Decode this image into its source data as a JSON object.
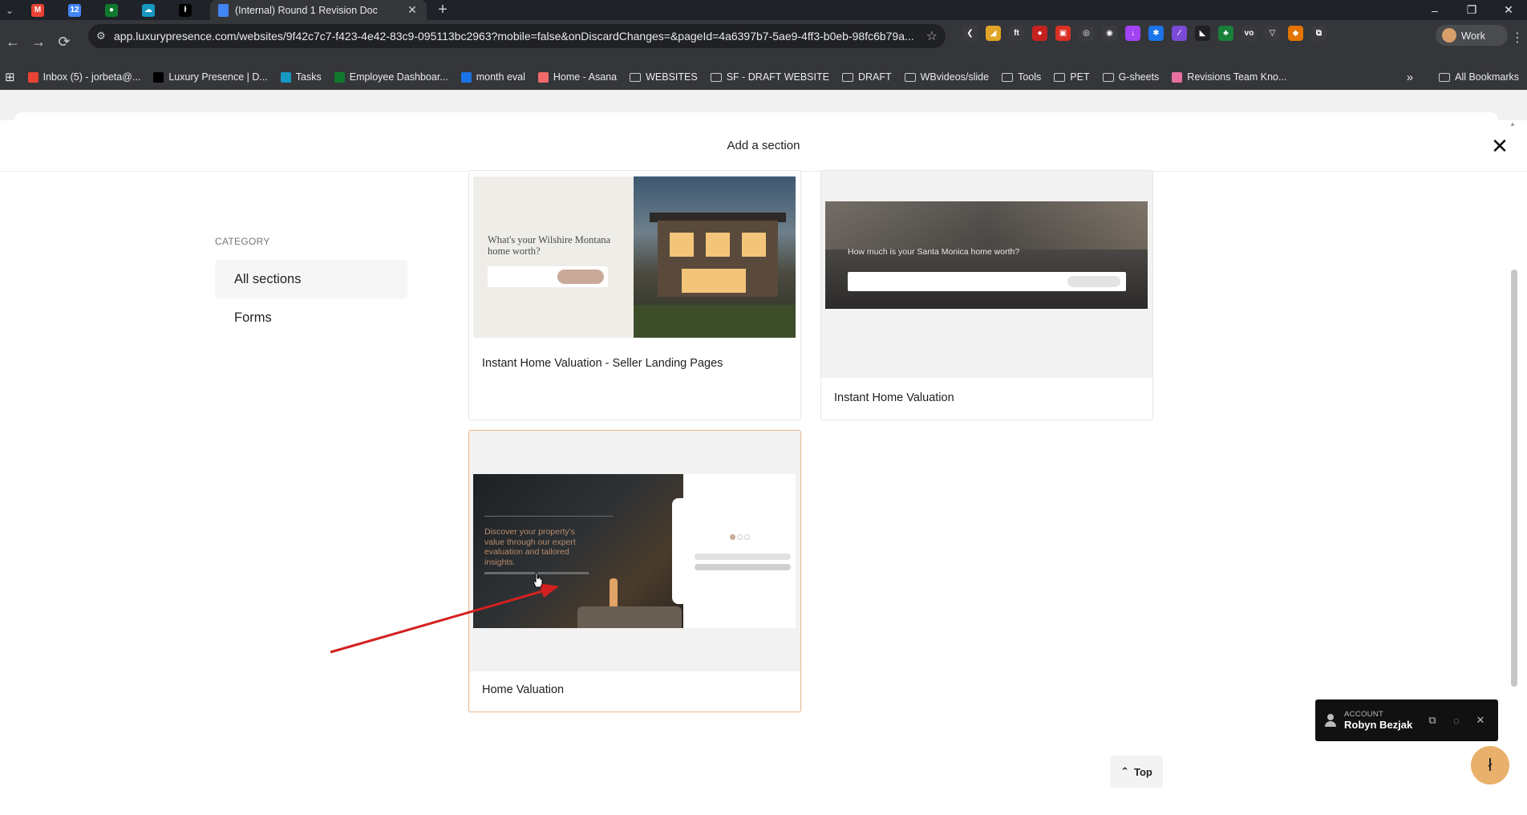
{
  "browser": {
    "tab_menu_glyph": "⌄",
    "pinned_tabs": [
      {
        "icon": "gmail-icon",
        "glyph": "M",
        "color": "#ea4335"
      },
      {
        "icon": "calendar-icon",
        "glyph": "12",
        "color": "#4285f4"
      },
      {
        "icon": "app-green-icon",
        "glyph": "●",
        "color": "#0f7a2d"
      },
      {
        "icon": "cloud-icon",
        "glyph": "☁",
        "color": "#1798c1"
      },
      {
        "icon": "luxury-presence-icon",
        "glyph": "ł",
        "color": "#000000"
      }
    ],
    "active_tab": {
      "title": "(Internal) Round 1 Revision Doc",
      "icon": "google-docs-icon",
      "close": "✕"
    },
    "new_tab": "+",
    "window_controls": [
      "–",
      "❐",
      "✕"
    ],
    "nav": {
      "back": "←",
      "forward": "→",
      "reload": "⟳"
    },
    "url": "app.luxurypresence.com/websites/9f42c7c7-f423-4e42-83c9-095113bc2963?mobile=false&onDiscardChanges=&pageId=4a6397b7-5ae9-4ff3-b0eb-98fc6b79a...",
    "site_info_glyph": "⚙",
    "star": "☆",
    "extensions": [
      {
        "name": "extension-1-icon",
        "color": "#3a3b3e",
        "glyph": "❮"
      },
      {
        "name": "extension-2-icon",
        "color": "#e0a526",
        "glyph": "◢"
      },
      {
        "name": "extension-3-icon",
        "color": "#3a3b3e",
        "glyph": "ft"
      },
      {
        "name": "extension-4-icon",
        "color": "#c5221f",
        "glyph": "●"
      },
      {
        "name": "extension-5-icon",
        "color": "#d93025",
        "glyph": "▣"
      },
      {
        "name": "extension-6-icon",
        "color": "#3a3b3e",
        "glyph": "◎"
      },
      {
        "name": "extension-7-icon",
        "color": "#3a3b3e",
        "glyph": "◉"
      },
      {
        "name": "extension-8-icon",
        "color": "#a142f4",
        "glyph": "↓"
      },
      {
        "name": "extension-9-icon",
        "color": "#1a73e8",
        "glyph": "✱"
      },
      {
        "name": "extension-10-icon",
        "color": "#7b4ad6",
        "glyph": "∕"
      },
      {
        "name": "extension-11-icon",
        "color": "#202124",
        "glyph": "◣"
      },
      {
        "name": "extension-12-icon",
        "color": "#188038",
        "glyph": "♣"
      },
      {
        "name": "extension-13-icon",
        "color": "#3a3b3e",
        "glyph": "vo"
      },
      {
        "name": "extension-14-icon",
        "color": "#3a3b3e",
        "glyph": "▽"
      },
      {
        "name": "extension-15-icon",
        "color": "#e37400",
        "glyph": "◆"
      },
      {
        "name": "extensions-puzzle-icon",
        "color": "#3a3b3e",
        "glyph": "⧉"
      }
    ],
    "profile_label": "Work",
    "menu_glyph": "⋮",
    "apps_glyph": "⊞",
    "bookmarks": [
      {
        "label": "Inbox (5) - jorbeta@...",
        "color": "#ea4335"
      },
      {
        "label": "Luxury Presence | D...",
        "color": "#000000"
      },
      {
        "label": "Tasks",
        "color": "#1798c1"
      },
      {
        "label": "Employee Dashboar...",
        "color": "#0f7a2d"
      },
      {
        "label": "month eval",
        "color": "#1a73e8"
      },
      {
        "label": "Home - Asana",
        "color": "#f06a6a"
      },
      {
        "label": "WEBSITES",
        "folder": true
      },
      {
        "label": "SF - DRAFT WEBSITE",
        "folder": true
      },
      {
        "label": "DRAFT",
        "folder": true
      },
      {
        "label": "WBvideos/slide",
        "folder": true
      },
      {
        "label": "Tools",
        "folder": true
      },
      {
        "label": "PET",
        "folder": true
      },
      {
        "label": "G-sheets",
        "folder": true
      },
      {
        "label": "Revisions Team Kno...",
        "color": "#e86fa0"
      }
    ],
    "bookmarks_more": "»",
    "all_bookmarks": "All Bookmarks"
  },
  "modal": {
    "title": "Add a section",
    "close_glyph": "✕",
    "category_label": "CATEGORY",
    "categories": [
      "All sections",
      "Forms"
    ],
    "cards": [
      {
        "label": "Instant Home Valuation - Seller Landing Pages",
        "preview_heading": "What's your Wilshire Montana home worth?"
      },
      {
        "label": "Instant Home Valuation",
        "preview_heading": "How much is your Santa Monica home worth?"
      },
      {
        "label": "Home Valuation",
        "preview_heading": "Discover your property's value through our expert evaluation and tailored insights."
      }
    ]
  },
  "account": {
    "label": "ACCOUNT",
    "name": "Robyn Bezjak",
    "copy_glyph": "⧉",
    "hide_glyph": "◌",
    "close_glyph": "✕"
  },
  "top_button": {
    "label": "Top",
    "glyph": "⌃"
  },
  "fab_glyph": "ł",
  "colors": {
    "annotation_arrow": "#d42020",
    "selected_border": "#e8b48a",
    "fab": "#e8b06a"
  }
}
